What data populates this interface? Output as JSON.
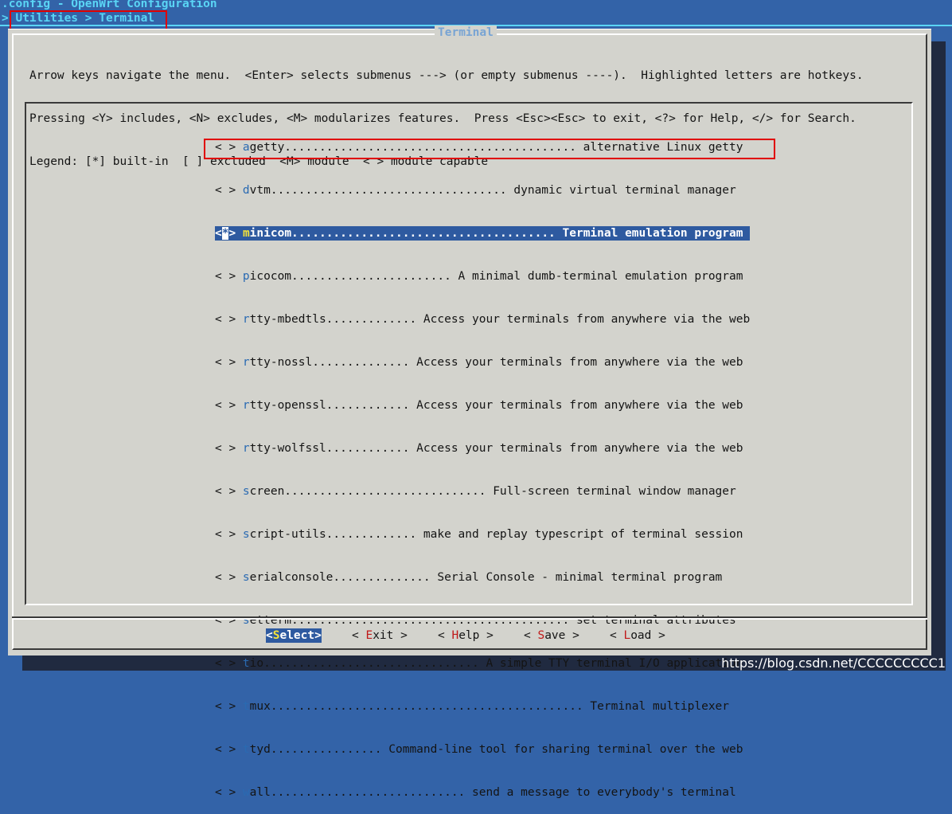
{
  "header": {
    "title": ".config - OpenWrt Configuration",
    "breadcrumb": "> Utilities > Terminal"
  },
  "dialog": {
    "title": "Terminal",
    "help_lines": [
      "Arrow keys navigate the menu.  <Enter> selects submenus ---> (or empty submenus ----).  Highlighted letters are hotkeys.",
      "Pressing <Y> includes, <N> excludes, <M> modularizes features.  Press <Esc><Esc> to exit, <?> for Help, </> for Search.",
      "Legend: [*] built-in  [ ] excluded  <M> module  < > module capable"
    ]
  },
  "menu": {
    "items": [
      {
        "prefix": "< > ",
        "hotkey": "a",
        "rest": "getty.......................................... alternative Linux getty"
      },
      {
        "prefix": "< > ",
        "hotkey": "d",
        "rest": "vtm.................................. dynamic virtual terminal manager"
      },
      {
        "mark_open": "<",
        "mark": "*",
        "mark_close": "> ",
        "hotkey": "m",
        "rest": "inicom...................................... Terminal emulation program",
        "selected": true
      },
      {
        "prefix": "< > ",
        "hotkey": "p",
        "rest": "icocom....................... A minimal dumb-terminal emulation program"
      },
      {
        "prefix": "< > ",
        "hotkey": "r",
        "rest": "tty-mbedtls............. Access your terminals from anywhere via the web"
      },
      {
        "prefix": "< > ",
        "hotkey": "r",
        "rest": "tty-nossl.............. Access your terminals from anywhere via the web"
      },
      {
        "prefix": "< > ",
        "hotkey": "r",
        "rest": "tty-openssl............ Access your terminals from anywhere via the web"
      },
      {
        "prefix": "< > ",
        "hotkey": "r",
        "rest": "tty-wolfssl............ Access your terminals from anywhere via the web"
      },
      {
        "prefix": "< > ",
        "hotkey": "s",
        "rest": "creen............................. Full-screen terminal window manager"
      },
      {
        "prefix": "< > ",
        "hotkey": "s",
        "rest": "cript-utils............. make and replay typescript of terminal session"
      },
      {
        "prefix": "< > ",
        "hotkey": "s",
        "rest": "erialconsole.............. Serial Console - minimal terminal program"
      },
      {
        "prefix": "< > ",
        "hotkey": "s",
        "rest": "etterm........................................ set terminal attributes"
      },
      {
        "prefix": "< > ",
        "hotkey": "t",
        "rest": "io............................... A simple TTY terminal I/O application"
      },
      {
        "prefix": "< > ",
        "hotkey": "t",
        "rest": "mux............................................. Terminal multiplexer"
      },
      {
        "prefix": "< > ",
        "hotkey": "t",
        "rest": "tyd................ Command-line tool for sharing terminal over the web"
      },
      {
        "prefix": "< > ",
        "hotkey": "w",
        "rest": "all............................ send a message to everybody's terminal"
      }
    ]
  },
  "buttons": {
    "select": {
      "open": "<",
      "hotkey": "S",
      "rest": "elect",
      "close": ">"
    },
    "exit": {
      "open": "< ",
      "hotkey": "E",
      "rest": "xit",
      "close": " >"
    },
    "help": {
      "open": "< ",
      "hotkey": "H",
      "rest": "elp",
      "close": " >"
    },
    "save": {
      "open": "< ",
      "hotkey": "S",
      "rest": "ave",
      "close": " >"
    },
    "load": {
      "open": "< ",
      "hotkey": "L",
      "rest": "oad",
      "close": " >"
    }
  },
  "watermark": "https://blog.csdn.net/CCCCCCCCC1",
  "colors": {
    "background": "#3363a8",
    "dialog": "#d3d3cd",
    "selection": "#2e5aa0",
    "hotkey": "#2a6ab2",
    "hotkey_selected": "#f4e23a",
    "button_hotkey": "#c01818",
    "annotation": "#e00000"
  }
}
